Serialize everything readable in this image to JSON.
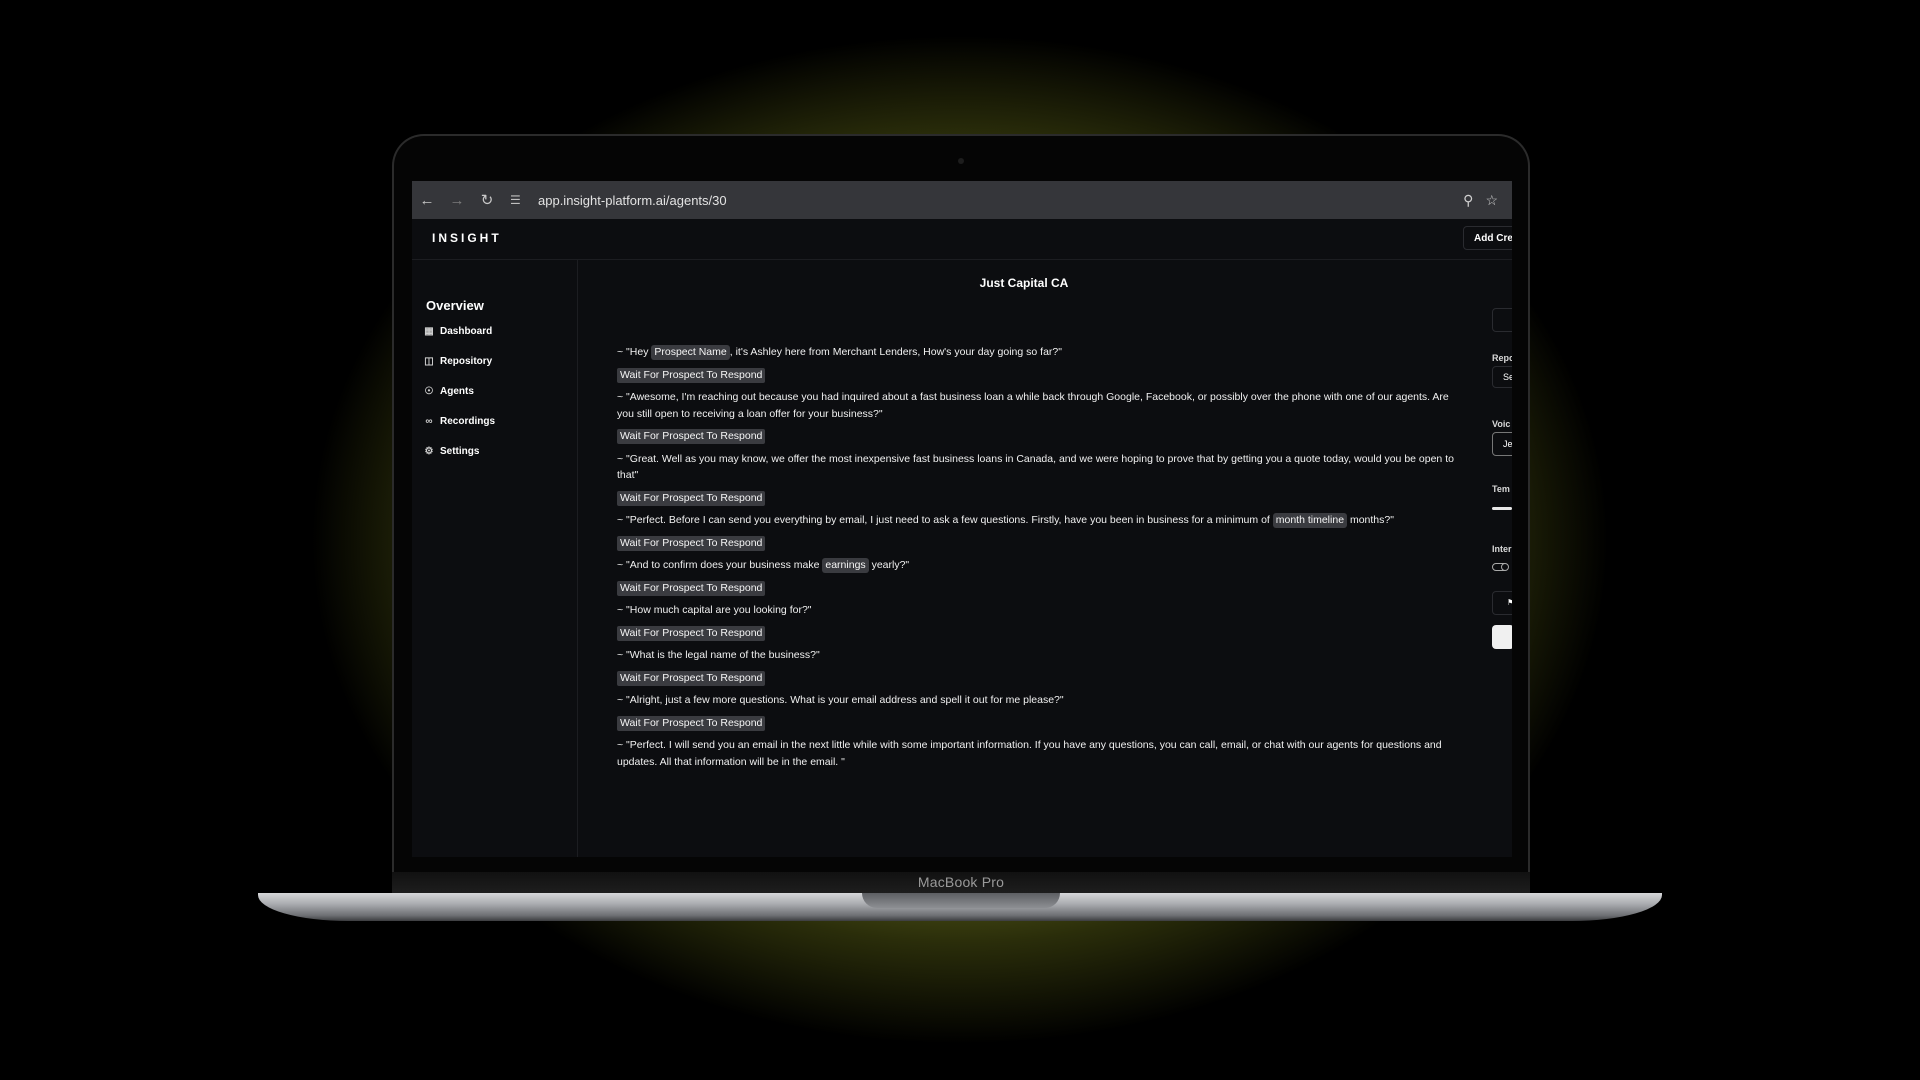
{
  "device": {
    "label": "MacBook Pro"
  },
  "browser": {
    "url": "app.insight-platform.ai/agents/30",
    "back_icon": "arrow-left-icon",
    "forward_icon": "arrow-right-icon",
    "reload_icon": "reload-icon",
    "site_settings_icon": "tune-icon",
    "zoom_icon": "magnifier-icon",
    "bookmark_icon": "star-icon"
  },
  "app": {
    "logo": "INSIGHT",
    "add_button": "Add Cre"
  },
  "sidebar": {
    "title": "Overview",
    "items": [
      {
        "label": "Dashboard",
        "icon": "grid-icon"
      },
      {
        "label": "Repository",
        "icon": "database-icon"
      },
      {
        "label": "Agents",
        "icon": "headset-icon"
      },
      {
        "label": "Recordings",
        "icon": "link-icon"
      },
      {
        "label": "Settings",
        "icon": "gear-icon"
      }
    ]
  },
  "main": {
    "title": "Just Capital CA",
    "wait_label": "Wait For Prospect To Respond",
    "script": [
      {
        "pre": "~ \"Hey ",
        "tag": "Prospect Name",
        "post": ", it's Ashley here from Merchant Lenders, How's your day going so far?\""
      },
      {
        "pre": "~ \"Awesome, I'm reaching out because you had inquired about a fast business loan a while back through Google, Facebook, or possibly over the phone with one of our agents. Are you still open to receiving a loan offer for your business?\"",
        "tag": "",
        "post": ""
      },
      {
        "pre": "~ \"Great. Well as you may know, we offer the most inexpensive fast business loans in Canada, and we were hoping to prove that by getting you a quote today, would you be open to that\"",
        "tag": "",
        "post": ""
      },
      {
        "pre": "~ \"Perfect. Before I can send you everything by email, I just need to ask a few questions. Firstly, have you been in business for a minimum of ",
        "tag": "month timeline",
        "post": " months?\""
      },
      {
        "pre": "~ \"And to confirm does your business make ",
        "tag": "earnings",
        "post": " yearly?\""
      },
      {
        "pre": "~ \"How much capital are you looking for?\"",
        "tag": "",
        "post": ""
      },
      {
        "pre": "~ \"What is the legal name of the business?\"",
        "tag": "",
        "post": ""
      },
      {
        "pre": "~ \"Alright, just a few more questions. What is your email address and spell it out for me please?\"",
        "tag": "",
        "post": ""
      },
      {
        "pre": "~ \"Perfect. I will send you an email in the next little while with some important information. If you have any questions, you can call, email, or chat with our agents for questions and updates. All that information will be in the email. \"",
        "tag": "",
        "post": ""
      }
    ]
  },
  "right_panel": {
    "repo_label": "Repo",
    "repo_value": "Se",
    "voice_label": "Voic",
    "voice_value": "Je",
    "temp_label": "Tem",
    "inter_label": "Inter",
    "temperature": 0.9,
    "interrupt_toggle": true
  }
}
